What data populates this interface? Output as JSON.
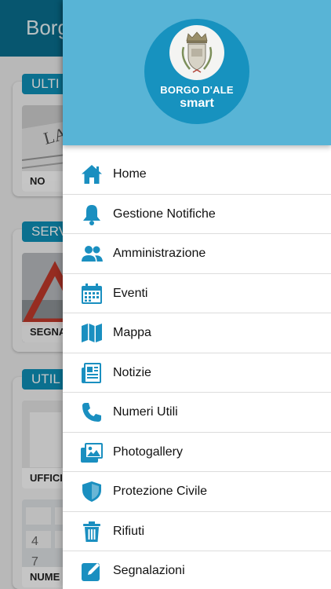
{
  "app": {
    "title": "Borgo",
    "accent_color": "#0a6f8f",
    "sections": [
      {
        "badge": "ULTI",
        "tiles": [
          {
            "label": "NO"
          }
        ]
      },
      {
        "badge": "SERV",
        "tiles": [
          {
            "label": "SEGNA"
          }
        ]
      },
      {
        "badge": "UTIL",
        "tiles": [
          {
            "label": "UFFICI C"
          },
          {
            "label": "NUME"
          }
        ]
      }
    ]
  },
  "drawer": {
    "header_color": "#58b4d6",
    "logo": {
      "line1": "BORGO D'ALE",
      "line2": "smart"
    },
    "icon_color": "#1a8fc0",
    "items": [
      {
        "label": "Home",
        "icon": "home-icon"
      },
      {
        "label": "Gestione Notifiche",
        "icon": "bell-icon"
      },
      {
        "label": "Amministrazione",
        "icon": "users-icon"
      },
      {
        "label": "Eventi",
        "icon": "calendar-icon"
      },
      {
        "label": "Mappa",
        "icon": "map-icon"
      },
      {
        "label": "Notizie",
        "icon": "newspaper-icon"
      },
      {
        "label": "Numeri Utili",
        "icon": "phone-icon"
      },
      {
        "label": "Photogallery",
        "icon": "images-icon"
      },
      {
        "label": "Protezione Civile",
        "icon": "shield-icon"
      },
      {
        "label": "Rifiuti",
        "icon": "trash-icon"
      },
      {
        "label": "Segnalazioni",
        "icon": "edit-icon"
      }
    ]
  }
}
